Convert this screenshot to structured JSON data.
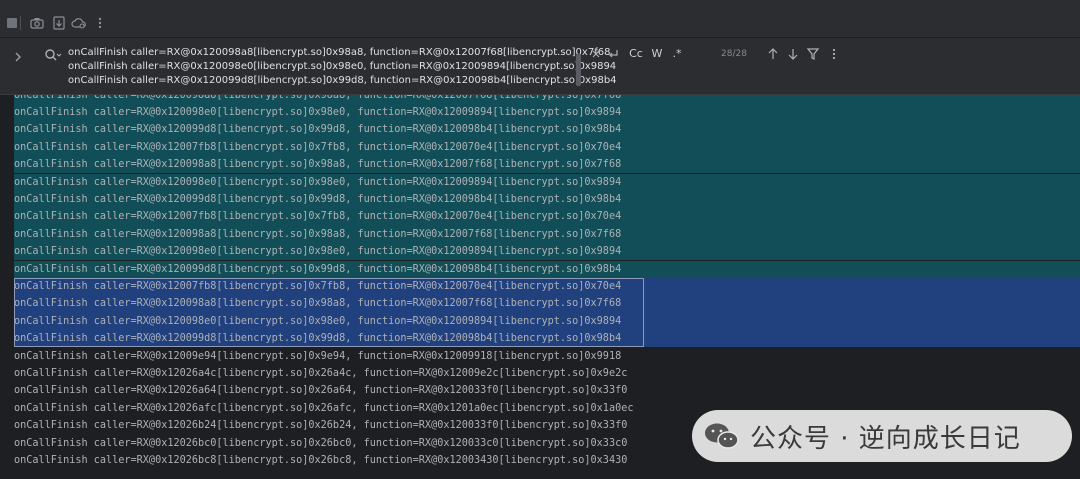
{
  "toolbar": {
    "icons": [
      "stop-icon",
      "camera-icon",
      "export-icon",
      "cloud-search-icon",
      "more-vertical-icon"
    ]
  },
  "search": {
    "query_lines": [
      "onCallFinish caller=RX@0x120098a8[libencrypt.so]0x98a8, function=RX@0x12007f68[libencrypt.so]0x7f68",
      "onCallFinish caller=RX@0x120098e0[libencrypt.so]0x98e0, function=RX@0x12009894[libencrypt.so]0x9894",
      "onCallFinish caller=RX@0x120099d8[libencrypt.so]0x99d8, function=RX@0x120098b4[libencrypt.so]0x98b4"
    ],
    "case_label": "Cc",
    "word_label": "W",
    "regex_label": ".*",
    "match_count": "28/28"
  },
  "log": {
    "lines": [
      {
        "text": "onCallFinish caller=RX@0x120098a8[libencrypt.so]0x98a8, function=RX@0x12007f68[libencrypt.so]0x7f68",
        "state": "hl"
      },
      {
        "text": "onCallFinish caller=RX@0x120098e0[libencrypt.so]0x98e0, function=RX@0x12009894[libencrypt.so]0x9894",
        "state": "hl"
      },
      {
        "text": "onCallFinish caller=RX@0x120099d8[libencrypt.so]0x99d8, function=RX@0x120098b4[libencrypt.so]0x98b4",
        "state": "hl"
      },
      {
        "text": "onCallFinish caller=RX@0x12007fb8[libencrypt.so]0x7fb8, function=RX@0x120070e4[libencrypt.so]0x70e4",
        "state": "hl"
      },
      {
        "text": "onCallFinish caller=RX@0x120098a8[libencrypt.so]0x98a8, function=RX@0x12007f68[libencrypt.so]0x7f68",
        "state": "hl"
      },
      {
        "text": "onCallFinish caller=RX@0x120098e0[libencrypt.so]0x98e0, function=RX@0x12009894[libencrypt.so]0x9894",
        "state": "hl"
      },
      {
        "text": "onCallFinish caller=RX@0x120099d8[libencrypt.so]0x99d8, function=RX@0x120098b4[libencrypt.so]0x98b4",
        "state": "hl"
      },
      {
        "text": "onCallFinish caller=RX@0x12007fb8[libencrypt.so]0x7fb8, function=RX@0x120070e4[libencrypt.so]0x70e4",
        "state": "hl"
      },
      {
        "text": "onCallFinish caller=RX@0x120098a8[libencrypt.so]0x98a8, function=RX@0x12007f68[libencrypt.so]0x7f68",
        "state": "hl"
      },
      {
        "text": "onCallFinish caller=RX@0x120098e0[libencrypt.so]0x98e0, function=RX@0x12009894[libencrypt.so]0x9894",
        "state": "hl"
      },
      {
        "text": "onCallFinish caller=RX@0x120099d8[libencrypt.so]0x99d8, function=RX@0x120098b4[libencrypt.so]0x98b4",
        "state": "hl"
      },
      {
        "text": "onCallFinish caller=RX@0x12007fb8[libencrypt.so]0x7fb8, function=RX@0x120070e4[libencrypt.so]0x70e4",
        "state": "sel"
      },
      {
        "text": "onCallFinish caller=RX@0x120098a8[libencrypt.so]0x98a8, function=RX@0x12007f68[libencrypt.so]0x7f68",
        "state": "sel"
      },
      {
        "text": "onCallFinish caller=RX@0x120098e0[libencrypt.so]0x98e0, function=RX@0x12009894[libencrypt.so]0x9894",
        "state": "sel"
      },
      {
        "text": "onCallFinish caller=RX@0x120099d8[libencrypt.so]0x99d8, function=RX@0x120098b4[libencrypt.so]0x98b4",
        "state": "sel"
      },
      {
        "text": "onCallFinish caller=RX@0x12009e94[libencrypt.so]0x9e94, function=RX@0x12009918[libencrypt.so]0x9918",
        "state": "none"
      },
      {
        "text": "onCallFinish caller=RX@0x12026a4c[libencrypt.so]0x26a4c, function=RX@0x12009e2c[libencrypt.so]0x9e2c",
        "state": "none"
      },
      {
        "text": "onCallFinish caller=RX@0x12026a64[libencrypt.so]0x26a64, function=RX@0x120033f0[libencrypt.so]0x33f0",
        "state": "none"
      },
      {
        "text": "onCallFinish caller=RX@0x12026afc[libencrypt.so]0x26afc, function=RX@0x1201a0ec[libencrypt.so]0x1a0ec",
        "state": "none"
      },
      {
        "text": "onCallFinish caller=RX@0x12026b24[libencrypt.so]0x26b24, function=RX@0x120033f0[libencrypt.so]0x33f0",
        "state": "none"
      },
      {
        "text": "onCallFinish caller=RX@0x12026bc0[libencrypt.so]0x26bc0, function=RX@0x120033c0[libencrypt.so]0x33c0",
        "state": "none"
      },
      {
        "text": "onCallFinish caller=RX@0x12026bc8[libencrypt.so]0x26bc8, function=RX@0x12003430[libencrypt.so]0x3430",
        "state": "none"
      }
    ]
  },
  "watermark": {
    "text": "公众号 · 逆向成长日记"
  },
  "colors": {
    "match_highlight": "#124e57",
    "selection": "#20407e",
    "background": "#1e1f22"
  }
}
